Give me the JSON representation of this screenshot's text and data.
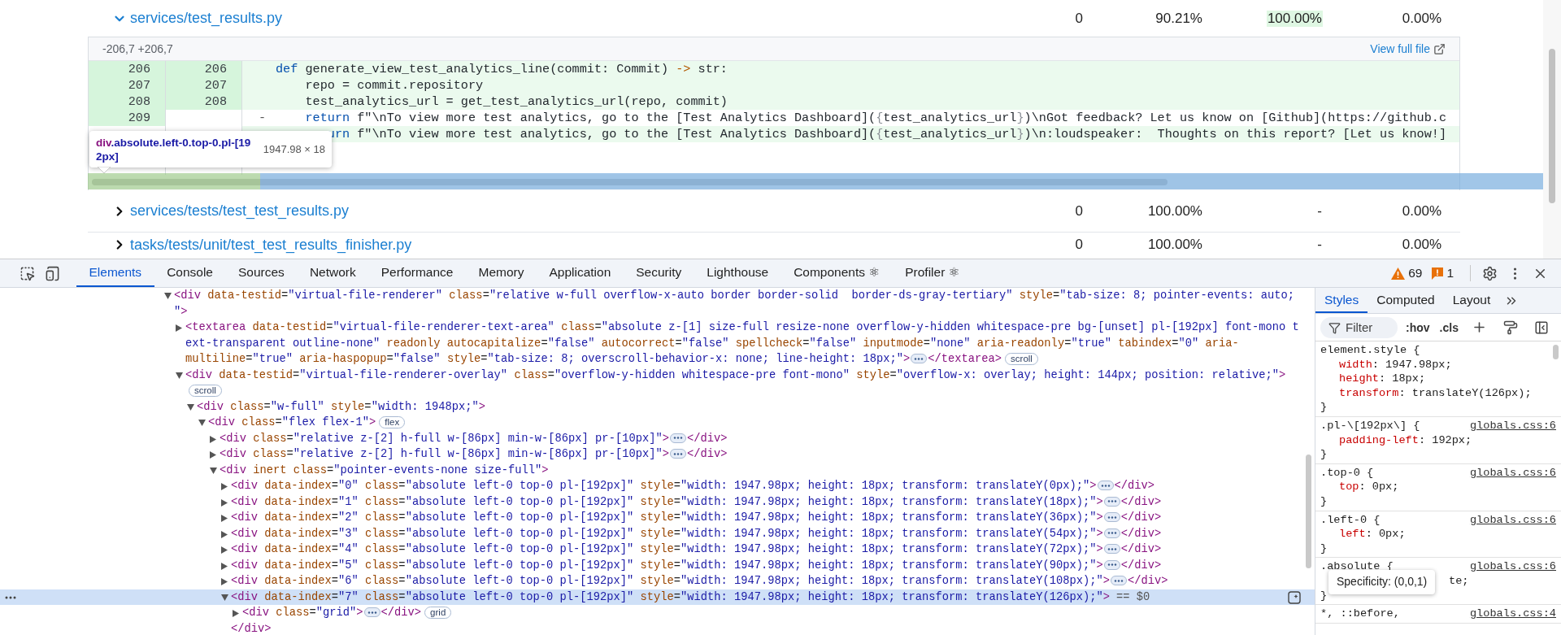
{
  "page": {
    "files": [
      {
        "path": "services/test_results.py",
        "expanded": true,
        "cells": [
          {
            "text": "0",
            "highlighted": false
          },
          {
            "text": "90.21%",
            "highlighted": false
          },
          {
            "text": "100.00%",
            "highlighted": true
          },
          {
            "text": "0.00%",
            "highlighted": false
          }
        ],
        "diff": {
          "hunk": "-206,7 +206,7",
          "link": "View full file",
          "lines": [
            {
              "old": "206",
              "new": "206",
              "covered": true,
              "segments": [
                {
                  "kind": "keyword",
                  "text": "def"
                },
                {
                  "kind": "plain",
                  "text": " generate_view_test_analytics_line(commit: Commit) "
                },
                {
                  "kind": "operator",
                  "text": "->"
                },
                {
                  "kind": "plain",
                  "text": " str:"
                }
              ]
            },
            {
              "old": "207",
              "new": "207",
              "covered": true,
              "segments": [
                {
                  "kind": "plain",
                  "text": "    repo = commit.repository"
                }
              ]
            },
            {
              "old": "208",
              "new": "208",
              "covered": true,
              "segments": [
                {
                  "kind": "plain",
                  "text": "    test_analytics_url = get_test_analytics_url(repo, commit)"
                }
              ]
            },
            {
              "old": "209",
              "marker": "-",
              "covered": false,
              "segments": [
                {
                  "kind": "keyword",
                  "text": "    return"
                },
                {
                  "kind": "plain",
                  "text": " f\"\\nTo view more test analytics, go to the [Test Analytics Dashboard]("
                },
                {
                  "kind": "punct",
                  "text": "{"
                },
                {
                  "kind": "plain",
                  "text": "test_analytics_url"
                },
                {
                  "kind": "punct",
                  "text": "}"
                },
                {
                  "kind": "plain",
                  "text": ")\\nGot feedback? Let us know on [Github](https://github.c"
                }
              ]
            },
            {
              "covered": true,
              "segments": [
                {
                  "kind": "keyword",
                  "text": "       urn"
                },
                {
                  "kind": "plain",
                  "text": " f\"\\nTo view more test analytics, go to the [Test Analytics Dashboard]("
                },
                {
                  "kind": "punct",
                  "text": "{"
                },
                {
                  "kind": "plain",
                  "text": "test_analytics_url"
                },
                {
                  "kind": "punct",
                  "text": "}"
                },
                {
                  "kind": "plain",
                  "text": ")\\n:loudspeaker:  Thoughts on this report? [Let us know!]"
                }
              ]
            }
          ]
        }
      },
      {
        "path": "services/tests/test_test_results.py",
        "expanded": false,
        "cells": [
          {
            "text": "0",
            "highlighted": false
          },
          {
            "text": "100.00%",
            "highlighted": false
          },
          {
            "text": "-",
            "highlighted": false
          },
          {
            "text": "0.00%",
            "highlighted": false
          }
        ]
      },
      {
        "path": "tasks/tests/unit/test_test_results_finisher.py",
        "expanded": false,
        "cells": [
          {
            "text": "0",
            "highlighted": false
          },
          {
            "text": "100.00%",
            "highlighted": false
          },
          {
            "text": "-",
            "highlighted": false
          },
          {
            "text": "0.00%",
            "highlighted": false
          }
        ]
      }
    ],
    "inspector_tooltip": {
      "tag": "div",
      "classes": ".absolute.left-0.top-0.pl-[192px]",
      "size": "1947.98 × 18"
    }
  },
  "devtools": {
    "tabs": [
      {
        "label": "Elements",
        "selected": true
      },
      {
        "label": "Console",
        "selected": false
      },
      {
        "label": "Sources",
        "selected": false
      },
      {
        "label": "Network",
        "selected": false
      },
      {
        "label": "Performance",
        "selected": false
      },
      {
        "label": "Memory",
        "selected": false
      },
      {
        "label": "Application",
        "selected": false
      },
      {
        "label": "Security",
        "selected": false
      },
      {
        "label": "Lighthouse",
        "selected": false
      },
      {
        "label": "Components ⚛",
        "selected": false
      },
      {
        "label": "Profiler ⚛",
        "selected": false
      }
    ],
    "warnings": "69",
    "issues": "1",
    "dom_tree": [
      {
        "markup": [
          "<div data-testid=\"virtual-file-renderer\" class=\"relative w-full overflow-x-auto border border-solid  border-ds-gray-tertiary\" style=\"tab-size: 8; pointer-events: auto;",
          "\">"
        ],
        "expanded": true,
        "selected": false,
        "children": [
          {
            "markup": [
              "<textarea data-testid=\"virtual-file-renderer-text-area\" class=\"absolute z-[1] size-full resize-none overflow-y-hidden whitespace-pre bg-[unset] pl-[192px] font-mono t",
              "ext-transparent outline-none\" readonly autocapitalize=\"false\" autocorrect=\"false\" spellcheck=\"false\" inputmode=\"none\" aria-readonly=\"true\" tabindex=\"0\" aria-",
              "multiline=\"true\" aria-haspopup=\"false\" style=\"tab-size: 8; overscroll-behavior-x: none; line-height: 18px;\">"
            ],
            "expanded": false,
            "selected": false,
            "closing": "</textarea>",
            "badges": [
              "scroll"
            ]
          },
          {
            "markup": [
              "<div data-testid=\"virtual-file-renderer-overlay\" class=\"overflow-y-hidden whitespace-pre font-mono\" style=\"overflow-x: overlay; height: 144px; position: relative;\">"
            ],
            "expanded": true,
            "selected": false,
            "badges": [
              "scroll"
            ],
            "children": [
              {
                "markup": [
                  "<div class=\"w-full\" style=\"width: 1948px;\">"
                ],
                "expanded": true,
                "selected": false,
                "children": [
                  {
                    "markup": [
                      "<div class=\"flex flex-1\">"
                    ],
                    "expanded": true,
                    "selected": false,
                    "badges": [
                      "flex"
                    ],
                    "children": [
                      {
                        "markup": [
                          "<div class=\"relative z-[2] h-full w-[86px] min-w-[86px] pr-[10px]\">"
                        ],
                        "expanded": false,
                        "selected": false,
                        "closing": "</div>"
                      },
                      {
                        "markup": [
                          "<div class=\"relative z-[2] h-full w-[86px] min-w-[86px] pr-[10px]\">"
                        ],
                        "expanded": false,
                        "selected": false,
                        "closing": "</div>"
                      },
                      {
                        "markup": [
                          "<div inert class=\"pointer-events-none size-full\">"
                        ],
                        "expanded": true,
                        "selected": false,
                        "children": [
                          {
                            "markup": [
                              "<div data-index=\"0\" class=\"absolute left-0 top-0 pl-[192px]\" style=\"width: 1947.98px; height: 18px; transform: translateY(0px);\">"
                            ],
                            "expanded": false,
                            "selected": false,
                            "closing": "</div>"
                          },
                          {
                            "markup": [
                              "<div data-index=\"1\" class=\"absolute left-0 top-0 pl-[192px]\" style=\"width: 1947.98px; height: 18px; transform: translateY(18px);\">"
                            ],
                            "expanded": false,
                            "selected": false,
                            "closing": "</div>"
                          },
                          {
                            "markup": [
                              "<div data-index=\"2\" class=\"absolute left-0 top-0 pl-[192px]\" style=\"width: 1947.98px; height: 18px; transform: translateY(36px);\">"
                            ],
                            "expanded": false,
                            "selected": false,
                            "closing": "</div>"
                          },
                          {
                            "markup": [
                              "<div data-index=\"3\" class=\"absolute left-0 top-0 pl-[192px]\" style=\"width: 1947.98px; height: 18px; transform: translateY(54px);\">"
                            ],
                            "expanded": false,
                            "selected": false,
                            "closing": "</div>"
                          },
                          {
                            "markup": [
                              "<div data-index=\"4\" class=\"absolute left-0 top-0 pl-[192px]\" style=\"width: 1947.98px; height: 18px; transform: translateY(72px);\">"
                            ],
                            "expanded": false,
                            "selected": false,
                            "closing": "</div>"
                          },
                          {
                            "markup": [
                              "<div data-index=\"5\" class=\"absolute left-0 top-0 pl-[192px]\" style=\"width: 1947.98px; height: 18px; transform: translateY(90px);\">"
                            ],
                            "expanded": false,
                            "selected": false,
                            "closing": "</div>"
                          },
                          {
                            "markup": [
                              "<div data-index=\"6\" class=\"absolute left-0 top-0 pl-[192px]\" style=\"width: 1947.98px; height: 18px; transform: translateY(108px);\">"
                            ],
                            "expanded": false,
                            "selected": false,
                            "closing": "</div>"
                          },
                          {
                            "markup": [
                              "<div data-index=\"7\" class=\"absolute left-0 top-0 pl-[192px]\" style=\"width: 1947.98px; height: 18px; transform: translateY(126px);\">"
                            ],
                            "expanded": true,
                            "selected": true,
                            "note": "== $0",
                            "closing_line": "</div>",
                            "children": [
                              {
                                "markup": [
                                  "<div class=\"grid\">"
                                ],
                                "expanded": false,
                                "selected": false,
                                "closing": "</div>",
                                "badges": [
                                  "grid"
                                ]
                              }
                            ]
                          }
                        ]
                      }
                    ]
                  }
                ]
              }
            ]
          }
        ]
      }
    ],
    "styles": {
      "tabs": [
        {
          "label": "Styles",
          "selected": true
        },
        {
          "label": "Computed",
          "selected": false
        },
        {
          "label": "Layout",
          "selected": false
        }
      ],
      "filter_placeholder": "Filter",
      "hov": ":hov",
      "cls": ".cls",
      "rules": [
        {
          "selector": "element.style {",
          "declarations": [
            {
              "property": "width",
              "rest": ": 1947.98px;"
            },
            {
              "property": "height",
              "rest": ": 18px;"
            },
            {
              "property": "transform",
              "rest": ": translateY(126px);"
            }
          ],
          "close": "}"
        },
        {
          "selector": ".pl-\\[192px\\] {",
          "source": "globals.css:6",
          "declarations": [
            {
              "property": "padding-left",
              "rest": ": 192px;"
            }
          ],
          "close": "}"
        },
        {
          "selector": ".top-0 {",
          "source": "globals.css:6",
          "declarations": [
            {
              "property": "top",
              "rest": ": 0px;"
            }
          ],
          "close": "}"
        },
        {
          "selector": ".left-0 {",
          "source": "globals.css:6",
          "declarations": [
            {
              "property": "left",
              "rest": ": 0px;"
            }
          ],
          "close": "}"
        },
        {
          "selector": ".absolute {",
          "source": "globals.css:6",
          "declarations": [
            {
              "kind": "covered",
              "rest": "te;"
            }
          ],
          "close": "}"
        },
        {
          "selector": "*, ::before,",
          "source": "globals.css:4"
        }
      ],
      "tooltip": "Specificity: (0,0,1)"
    }
  }
}
